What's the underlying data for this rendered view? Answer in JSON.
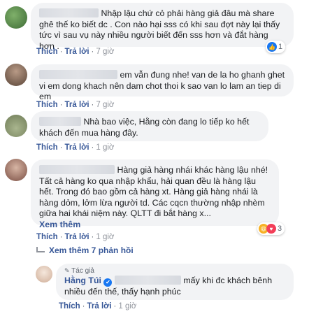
{
  "comments": [
    {
      "text": "Nhập lậu chứ cỏ phải hàng giả đâu mà share ghê thế ko biết dc . Con nào hại sss có khi sau đợt này lại thấy tức vì sau vụ này nhiều người biết đến sss hơn và đắt hàng hơn .",
      "like": "Thích",
      "reply": "Trả lời",
      "time": "7 giờ",
      "reactions": "1"
    },
    {
      "text": "em vẫn đung nhe! van de la ho ghanh ghet vi em dong khach nên dam chot thoi k sao van lo lam an tiep di em",
      "like": "Thích",
      "reply": "Trả lời",
      "time": "7 giờ"
    },
    {
      "text": "Nhà bao việc, Hằng còn đang lo tiếp ko hết khách đến mua hàng đây.",
      "like": "Thích",
      "reply": "Trả lời",
      "time": "1 giờ"
    },
    {
      "text": "Hàng giả hàng nhái khác hàng lậu nhé! Tất cả hàng ko qua nhập khẩu, hải quan đều là hàng lậu hết. Trong đó bao gồm cả hàng xt. Hàng giả hàng nhái là hàng dỏm, lởm lừa người td. Các cqcn thường nhập nhèm giữa hai khái niệm này. QLTT đi bắt hàng x...",
      "see_more": "Xem thêm",
      "like": "Thích",
      "reply": "Trả lời",
      "time": "1 giờ",
      "reactions": "3"
    }
  ],
  "view_more_replies": "Xem thêm 7 phản hồi",
  "reply": {
    "badge": "Tác giả",
    "author": "Hằng Túi",
    "text": "mấy khi đc khách bênh nhiều đến thế, thấy hạnh phúc",
    "like": "Thích",
    "reply": "Trả lời",
    "time": "1 giờ"
  },
  "colors": {
    "link": "#385898",
    "bubble": "#f2f3f5",
    "like_blue": "#1877f2",
    "haha_yellow": "#f7b125",
    "love_red": "#f33e58"
  }
}
